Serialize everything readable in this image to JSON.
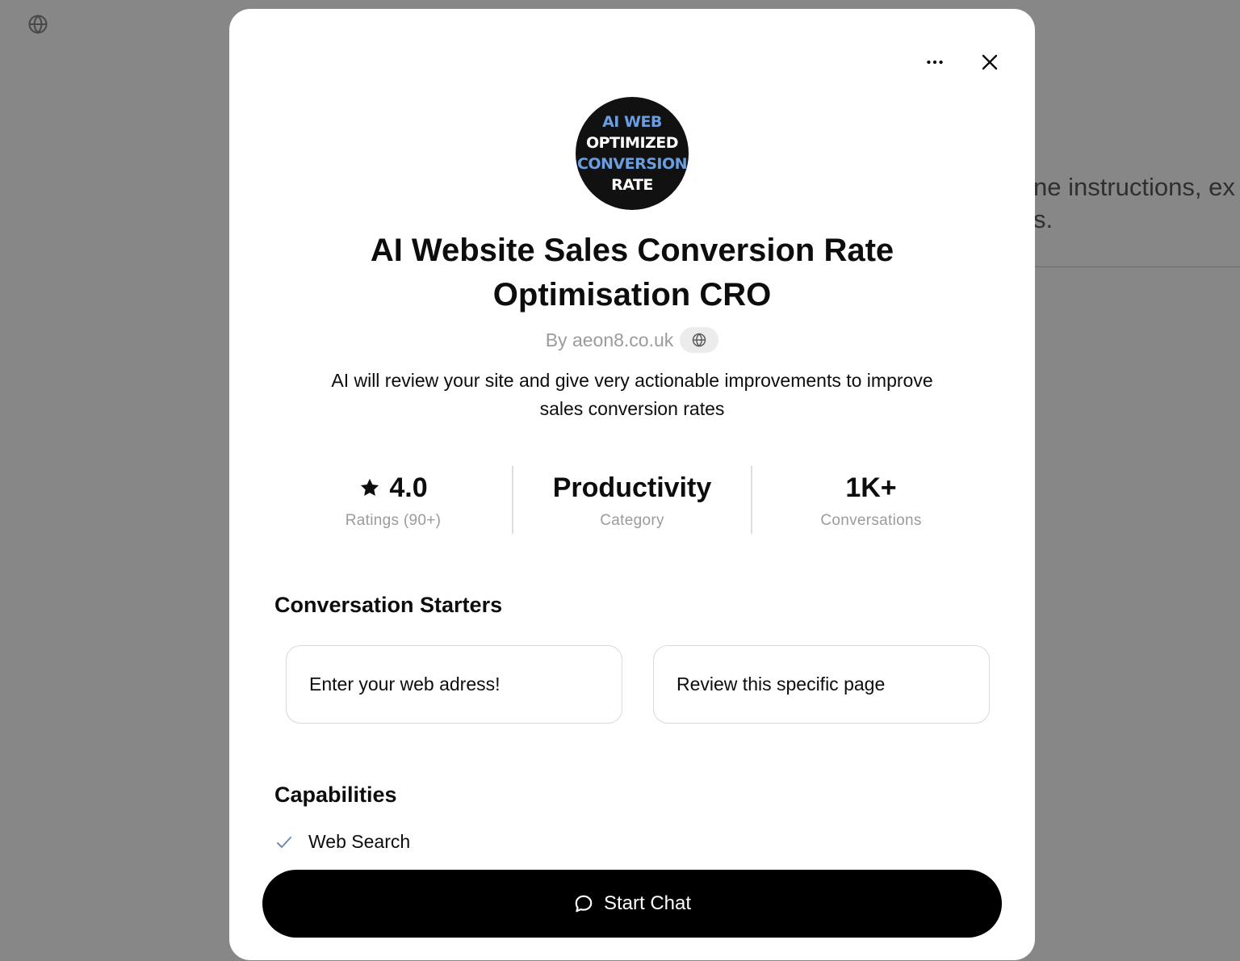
{
  "background": {
    "text_line1": "ne instructions, ex",
    "text_line2": "s."
  },
  "modal": {
    "avatar": {
      "lines": [
        "AI WEB",
        "OPTIMIZED",
        "CONVERSION",
        "RATE"
      ]
    },
    "title": "AI Website Sales Conversion Rate Optimisation CRO",
    "author": "By aeon8.co.uk",
    "description": "AI will review your site and give very actionable improvements to improve sales conversion rates",
    "stats": [
      {
        "value": "4.0",
        "label": "Ratings (90+)"
      },
      {
        "value": "Productivity",
        "label": "Category"
      },
      {
        "value": "1K+",
        "label": "Conversations"
      }
    ],
    "starters_title": "Conversation Starters",
    "starters": [
      "Enter your web adress!",
      "Review this specific page"
    ],
    "capabilities_title": "Capabilities",
    "capabilities": [
      "Web Search"
    ],
    "start_chat_label": "Start Chat"
  },
  "colors": {
    "overlay": "#000000",
    "accent_blue": "#6a9ee0",
    "check": "#6b8cb3",
    "primary_button": "#000000"
  },
  "icons": [
    "globe-icon",
    "more-icon",
    "close-icon",
    "star-icon",
    "check-icon",
    "chat-bubble-icon"
  ]
}
